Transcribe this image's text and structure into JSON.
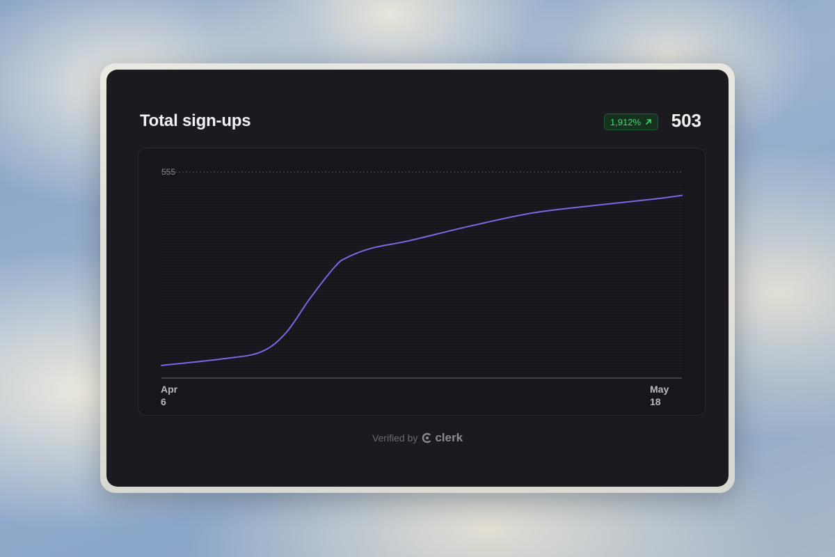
{
  "card": {
    "title": "Total sign-ups",
    "change_badge": "1,912%",
    "total_value": "503"
  },
  "footer": {
    "verified_text": "Verified by",
    "brand": "clerk"
  },
  "colors": {
    "line": "#7b68e8",
    "badge_text": "#3fd96f",
    "card_bg": "#1a1a1f"
  },
  "chart_data": {
    "type": "line",
    "x_tick_labels": [
      {
        "top": "Apr",
        "bottom": "6"
      },
      {
        "top": "May",
        "bottom": "18"
      }
    ],
    "y_max_label": "555",
    "ylim": [
      0,
      555
    ],
    "x": [
      0,
      5,
      8,
      10,
      12,
      14,
      15,
      17,
      20,
      25,
      30,
      35,
      40,
      42
    ],
    "values": [
      34,
      52,
      70,
      120,
      215,
      300,
      325,
      350,
      370,
      410,
      445,
      465,
      483,
      492
    ],
    "grid": false
  }
}
